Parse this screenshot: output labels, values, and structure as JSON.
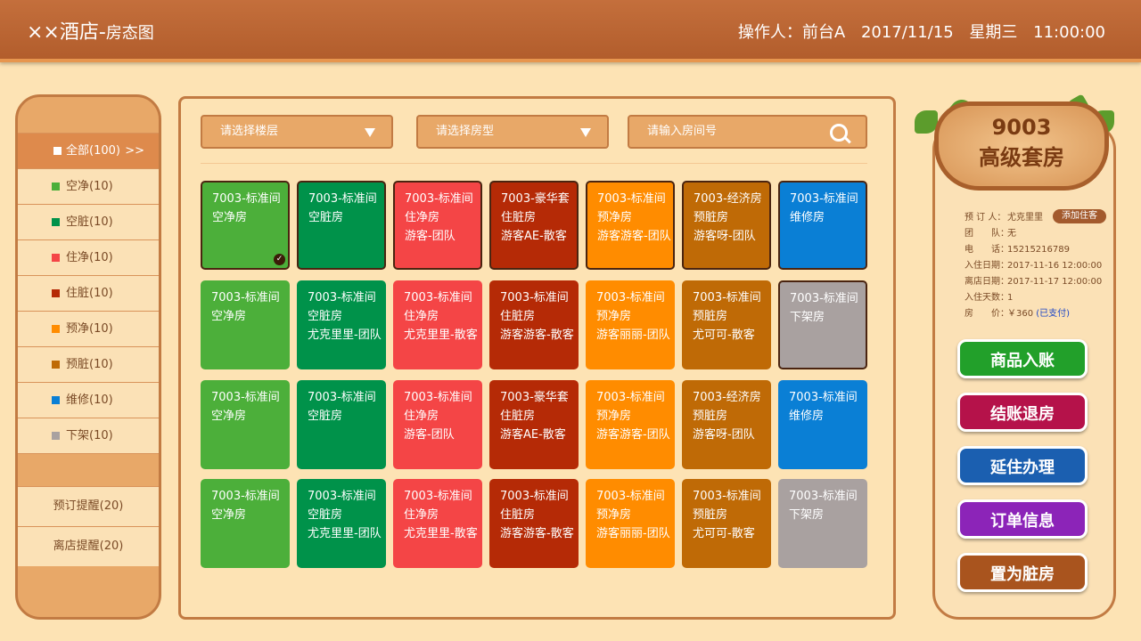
{
  "header": {
    "title_main": "××酒店-",
    "title_sub": "房态图",
    "operator": "操作人：前台A",
    "date": "2017/11/15",
    "weekday": "星期三",
    "time": "11:00:00"
  },
  "sidebar": {
    "filters": [
      {
        "label": "全部(100)",
        "color": "#ffffff",
        "arrow": ">>"
      },
      {
        "label": "空净(10)",
        "color": "#4caf3a"
      },
      {
        "label": "空脏(10)",
        "color": "#00924a"
      },
      {
        "label": "住净(10)",
        "color": "#f44546"
      },
      {
        "label": "住脏(10)",
        "color": "#b52a06"
      },
      {
        "label": "预净(10)",
        "color": "#ff8c00"
      },
      {
        "label": "预脏(10)",
        "color": "#bf6a06"
      },
      {
        "label": "维修(10)",
        "color": "#0a7fd5"
      },
      {
        "label": "下架(10)",
        "color": "#a9a1a0"
      }
    ],
    "reminders": [
      "预订提醒(20)",
      "离店提醒(20)"
    ]
  },
  "toolbar": {
    "floor_placeholder": "请选择楼层",
    "type_placeholder": "请选择房型",
    "room_placeholder": "请输入房间号"
  },
  "rooms": [
    [
      {
        "l1": "7003-标准间",
        "l2": "空净房",
        "l3": "",
        "color": "#4caf3a",
        "selected": true
      },
      {
        "l1": "7003-标准间",
        "l2": "空脏房",
        "l3": "",
        "color": "#00924a",
        "selected": true
      },
      {
        "l1": "7003-标准间",
        "l2": "住净房",
        "l3": "游客-团队",
        "color": "#f44546",
        "selected": true
      },
      {
        "l1": "7003-豪华套",
        "l2": "住脏房",
        "l3": "游客AE-散客",
        "color": "#b52a06",
        "selected": true
      },
      {
        "l1": "7003-标准间",
        "l2": "预净房",
        "l3": "游客游客-团队",
        "color": "#ff8c00",
        "selected": true
      },
      {
        "l1": "7003-经济房",
        "l2": "预脏房",
        "l3": "游客呀-团队",
        "color": "#bf6a06",
        "selected": true
      },
      {
        "l1": "7003-标准间",
        "l2": "维修房",
        "l3": "",
        "color": "#0a7fd5",
        "selected": true
      }
    ],
    [
      {
        "l1": "7003-标准间",
        "l2": "空净房",
        "l3": "",
        "color": "#4caf3a"
      },
      {
        "l1": "7003-标准间",
        "l2": "空脏房",
        "l3": "尤克里里-团队",
        "color": "#00924a"
      },
      {
        "l1": "7003-标准间",
        "l2": "住净房",
        "l3": "尤克里里-散客",
        "color": "#f44546"
      },
      {
        "l1": "7003-标准间",
        "l2": "住脏房",
        "l3": "游客游客-散客",
        "color": "#b52a06"
      },
      {
        "l1": "7003-标准间",
        "l2": "预净房",
        "l3": "游客丽丽-团队",
        "color": "#ff8c00"
      },
      {
        "l1": "7003-标准间",
        "l2": "预脏房",
        "l3": "尤可可-散客",
        "color": "#bf6a06"
      },
      {
        "l1": "7003-标准间",
        "l2": "下架房",
        "l3": "",
        "color": "#a9a1a0",
        "selected": true
      }
    ],
    [
      {
        "l1": "7003-标准间",
        "l2": "空净房",
        "l3": "",
        "color": "#4caf3a"
      },
      {
        "l1": "7003-标准间",
        "l2": "空脏房",
        "l3": "",
        "color": "#00924a"
      },
      {
        "l1": "7003-标准间",
        "l2": "住净房",
        "l3": "游客-团队",
        "color": "#f44546"
      },
      {
        "l1": "7003-豪华套",
        "l2": "住脏房",
        "l3": "游客AE-散客",
        "color": "#b52a06"
      },
      {
        "l1": "7003-标准间",
        "l2": "预净房",
        "l3": "游客游客-团队",
        "color": "#ff8c00"
      },
      {
        "l1": "7003-经济房",
        "l2": "预脏房",
        "l3": "游客呀-团队",
        "color": "#bf6a06"
      },
      {
        "l1": "7003-标准间",
        "l2": "维修房",
        "l3": "",
        "color": "#0a7fd5"
      }
    ],
    [
      {
        "l1": "7003-标准间",
        "l2": "空净房",
        "l3": "",
        "color": "#4caf3a"
      },
      {
        "l1": "7003-标准间",
        "l2": "空脏房",
        "l3": "尤克里里-团队",
        "color": "#00924a"
      },
      {
        "l1": "7003-标准间",
        "l2": "住净房",
        "l3": "尤克里里-散客",
        "color": "#f44546"
      },
      {
        "l1": "7003-标准间",
        "l2": "住脏房",
        "l3": "游客游客-散客",
        "color": "#b52a06"
      },
      {
        "l1": "7003-标准间",
        "l2": "预净房",
        "l3": "游客丽丽-团队",
        "color": "#ff8c00"
      },
      {
        "l1": "7003-标准间",
        "l2": "预脏房",
        "l3": "尤可可-散客",
        "color": "#bf6a06"
      },
      {
        "l1": "7003-标准间",
        "l2": "下架房",
        "l3": "",
        "color": "#a9a1a0"
      }
    ]
  ],
  "detail": {
    "room_number": "9003",
    "room_type": "高级套房",
    "booker_label": "预 订 人：",
    "booker": "尤克里里",
    "add_guest": "添加住客",
    "team_label": "团　　队：",
    "team": "无",
    "phone_label": "电　　话：",
    "phone": "15215216789",
    "checkin_label": "入住日期：",
    "checkin": "2017-11-16 12:00:00",
    "checkout_label": "离店日期：",
    "checkout": "2017-11-17 12:00:00",
    "days_label": "入住天数：",
    "days": "1",
    "price_label": "房　　价：",
    "price": "￥360",
    "paid": "(已支付)"
  },
  "actions": [
    {
      "label": "商品入账",
      "color": "#22a02a"
    },
    {
      "label": "结账退房",
      "color": "#b5124a"
    },
    {
      "label": "延住办理",
      "color": "#1b5fb0"
    },
    {
      "label": "订单信息",
      "color": "#8c24b8"
    },
    {
      "label": "置为脏房",
      "color": "#a9541e"
    }
  ]
}
